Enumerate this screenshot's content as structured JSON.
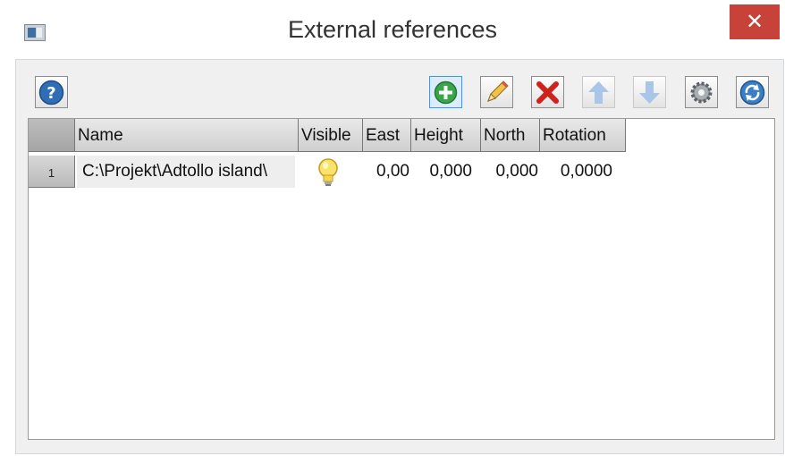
{
  "window": {
    "title": "External references",
    "close_glyph": "✕"
  },
  "toolbar": {
    "buttons": [
      {
        "name": "help",
        "icon": "help-icon",
        "tooltip": ""
      },
      {
        "name": "add",
        "icon": "add-icon"
      },
      {
        "name": "edit",
        "icon": "pencil-icon"
      },
      {
        "name": "delete",
        "icon": "delete-icon"
      },
      {
        "name": "move-up",
        "icon": "arrow-up-icon"
      },
      {
        "name": "move-down",
        "icon": "arrow-down-icon"
      },
      {
        "name": "settings",
        "icon": "gear-icon"
      },
      {
        "name": "refresh",
        "icon": "refresh-icon"
      }
    ]
  },
  "grid": {
    "columns": [
      "Name",
      "Visible",
      "East",
      "Height",
      "North",
      "Rotation"
    ],
    "rows": [
      {
        "index": "1",
        "name": "C:\\Projekt\\Adtollo island\\",
        "visible_icon": "lightbulb-icon",
        "east": "0,00",
        "height": "0,000",
        "north": "0,000",
        "rotation": "0,0000"
      }
    ]
  },
  "colors": {
    "close": "#c7433a",
    "accent": "#3399ff"
  }
}
